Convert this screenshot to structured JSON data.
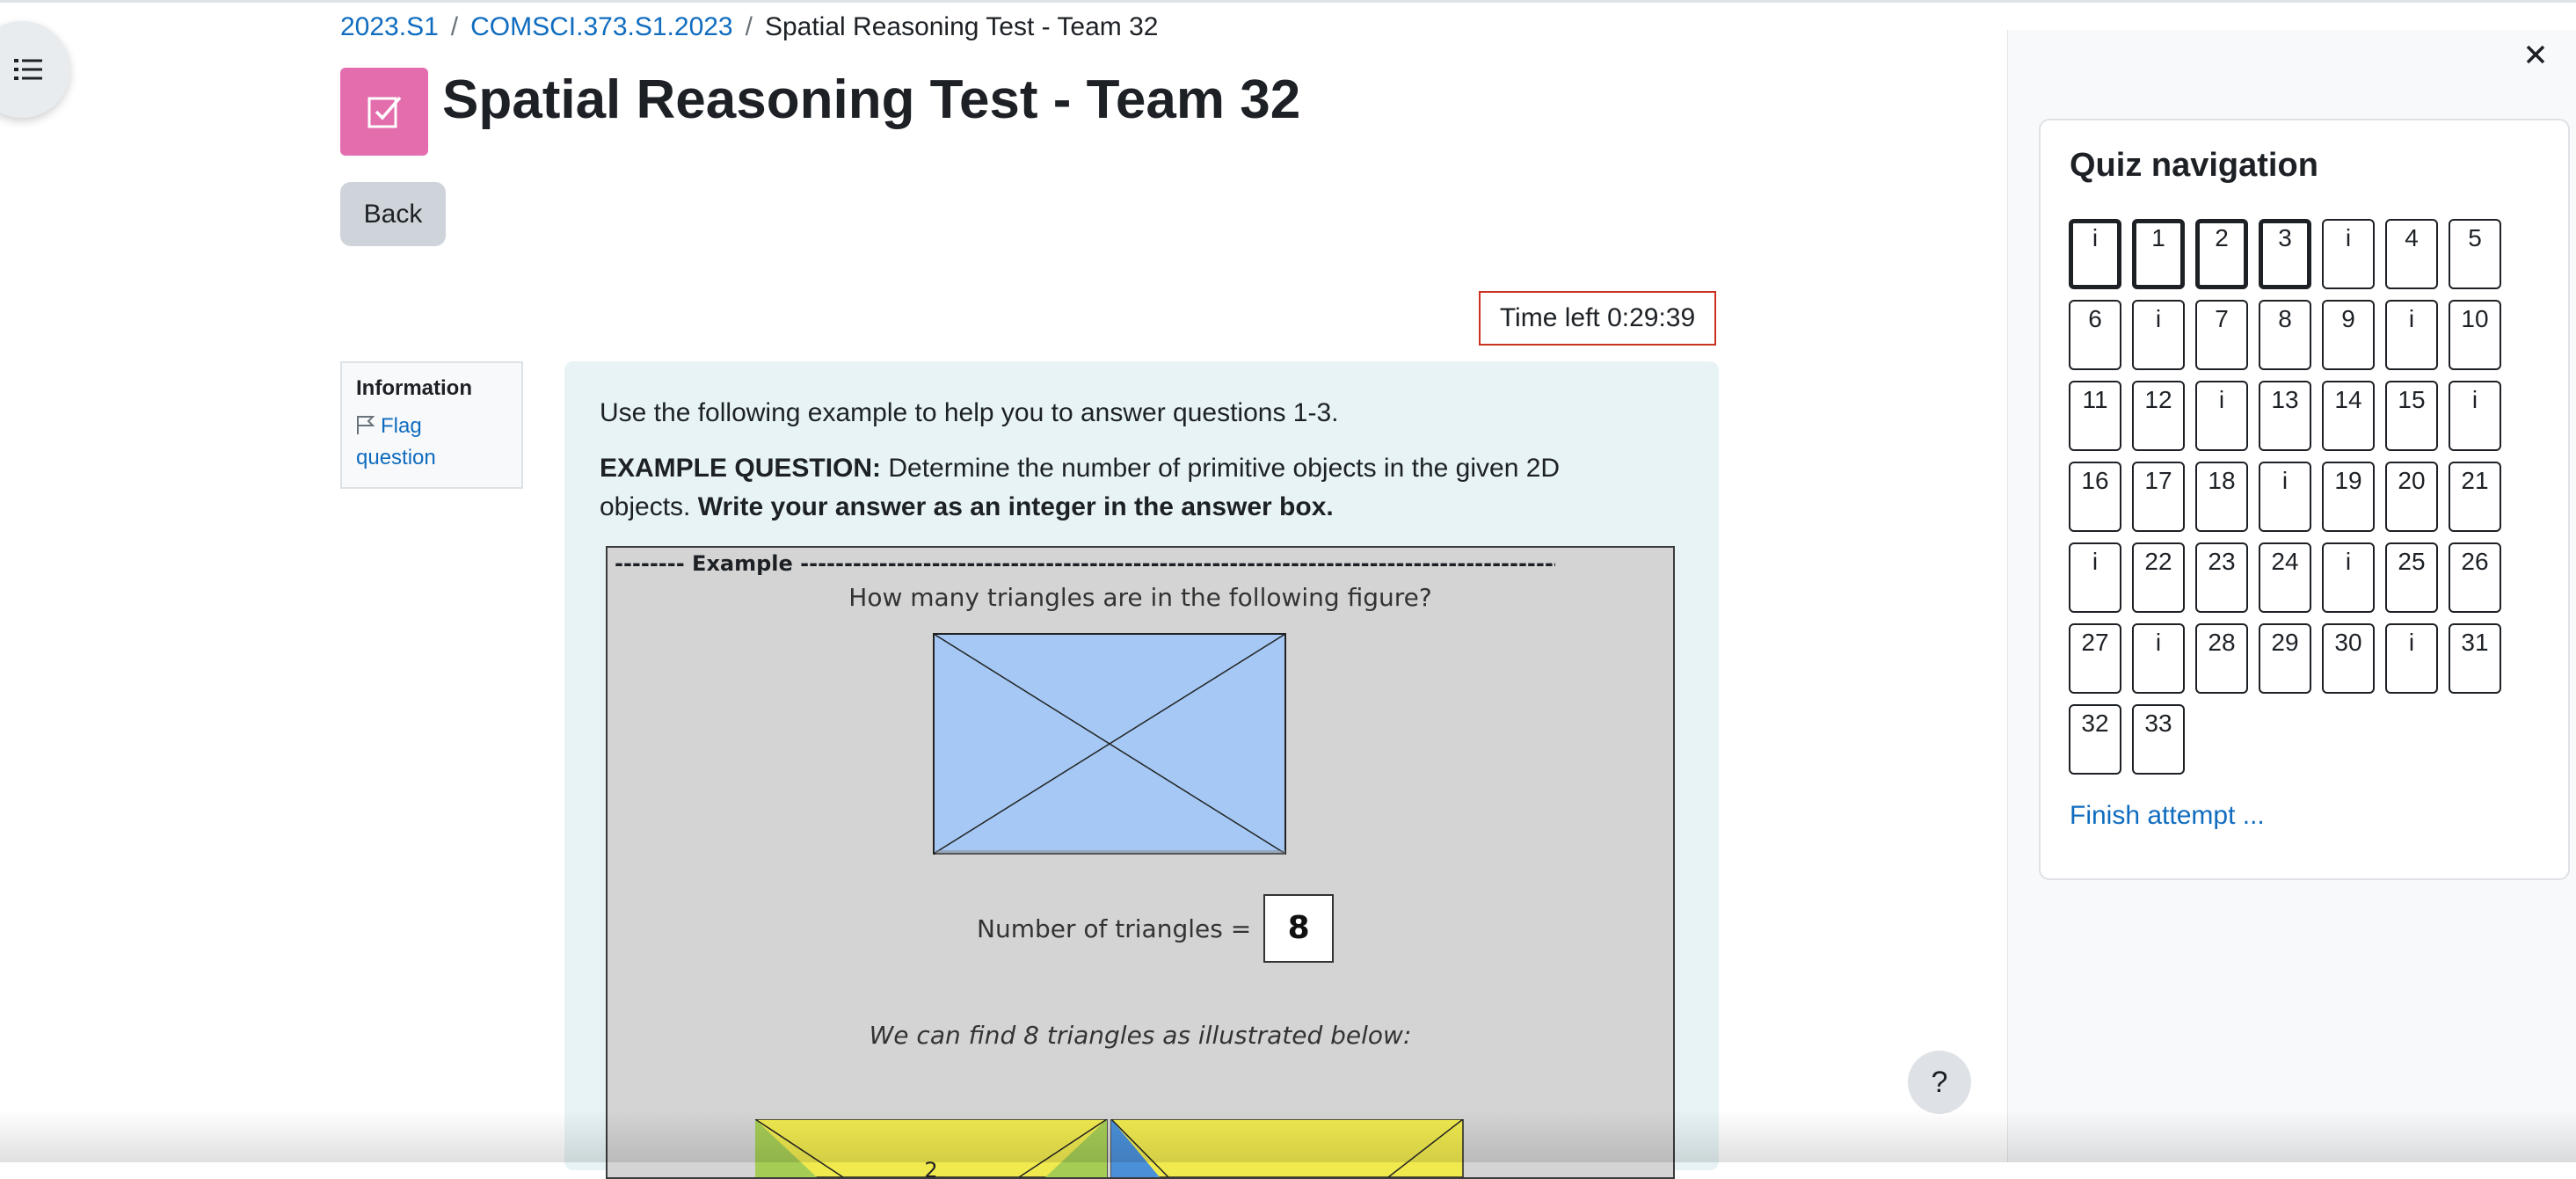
{
  "breadcrumb": {
    "items": [
      "2023.S1",
      "COMSCI.373.S1.2023",
      "Spatial Reasoning Test - Team 32"
    ],
    "separator": "/"
  },
  "page": {
    "title": "Spatial Reasoning Test - Team 32",
    "back_label": "Back",
    "timer_label": "Time left 0:29:39",
    "icon": "quiz-checkbox-icon",
    "accent_color": "#e36dad"
  },
  "info": {
    "title": "Information",
    "flag_label": "Flag question"
  },
  "question": {
    "intro": "Use the following example to help you to answer questions 1-3.",
    "prompt_bold": "EXAMPLE QUESTION:",
    "prompt_text": " Determine the number of primitive objects in the given 2D objects. ",
    "prompt_instruction": "Write your answer as an integer in the answer box."
  },
  "example": {
    "header": "-------- Example ------------------------------------------------------------------------------------------------------------",
    "question": "How many triangles are in the following figure?",
    "count_label": "Number of triangles =",
    "count_value": "8",
    "note": "We can find 8 triangles as illustrated below:",
    "partial_label": "2"
  },
  "help_label": "?",
  "quiz_nav": {
    "title": "Quiz navigation",
    "finish_label": "Finish attempt ...",
    "buttons": [
      "i",
      "1",
      "2",
      "3",
      "i",
      "4",
      "5",
      "6",
      "i",
      "7",
      "8",
      "9",
      "i",
      "10",
      "11",
      "12",
      "i",
      "13",
      "14",
      "15",
      "i",
      "16",
      "17",
      "18",
      "i",
      "19",
      "20",
      "21",
      "i",
      "22",
      "23",
      "24",
      "i",
      "25",
      "26",
      "27",
      "i",
      "28",
      "29",
      "30",
      "i",
      "31",
      "32",
      "33"
    ],
    "current_count": 4
  }
}
